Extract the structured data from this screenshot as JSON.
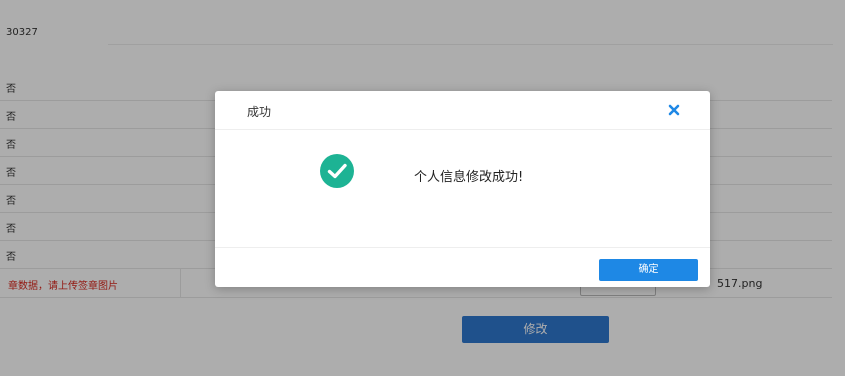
{
  "background": {
    "id_value": "30327",
    "radio_rows": [
      {
        "label": "否"
      },
      {
        "label": "否"
      },
      {
        "label": "否"
      },
      {
        "label": "否"
      },
      {
        "label": "否"
      },
      {
        "label": "否"
      },
      {
        "label": "否"
      }
    ],
    "sign_warning": "章数据，请上传签章图片",
    "file_name": "517.png",
    "modify_button_label": "修改"
  },
  "dialog": {
    "title": "成功",
    "close_icon": "close-icon",
    "success_icon": "check-circle-icon",
    "message": "个人信息修改成功!",
    "confirm_label": "确定"
  },
  "colors": {
    "overlay": "rgba(0,0,0,0.32)",
    "success_green": "#1db394",
    "primary_blue": "#1e88e5",
    "modify_blue": "#2f78cf",
    "close_blue": "#1e88e5",
    "warning_red": "#d9261c"
  }
}
